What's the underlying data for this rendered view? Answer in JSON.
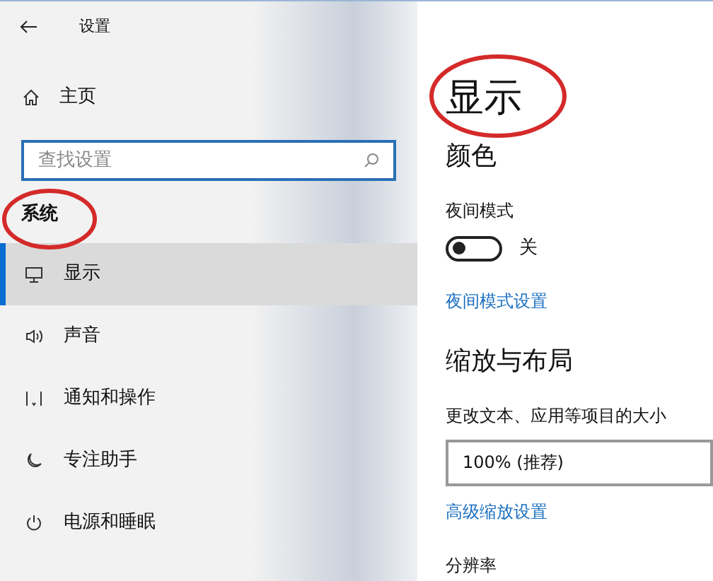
{
  "window": {
    "title": "设置"
  },
  "sidebar": {
    "home": "主页",
    "search": {
      "placeholder": "查找设置"
    },
    "section": "系统",
    "items": [
      {
        "label": "显示",
        "kind": "monitor",
        "selected": true
      },
      {
        "label": "声音",
        "kind": "speaker",
        "selected": false
      },
      {
        "label": "通知和操作",
        "kind": "notification",
        "selected": false
      },
      {
        "label": "专注助手",
        "kind": "moon",
        "selected": false
      },
      {
        "label": "电源和睡眠",
        "kind": "power",
        "selected": false
      }
    ]
  },
  "content": {
    "title": "显示",
    "color_heading": "颜色",
    "night_light": {
      "label": "夜间模式",
      "on": false,
      "state_text": "关"
    },
    "night_light_link": "夜间模式设置",
    "scale_heading": "缩放与布局",
    "scale_label": "更改文本、应用等项目的大小",
    "scale_value": "100% (推荐)",
    "advanced_link": "高级缩放设置",
    "resolution_label": "分辨率"
  }
}
